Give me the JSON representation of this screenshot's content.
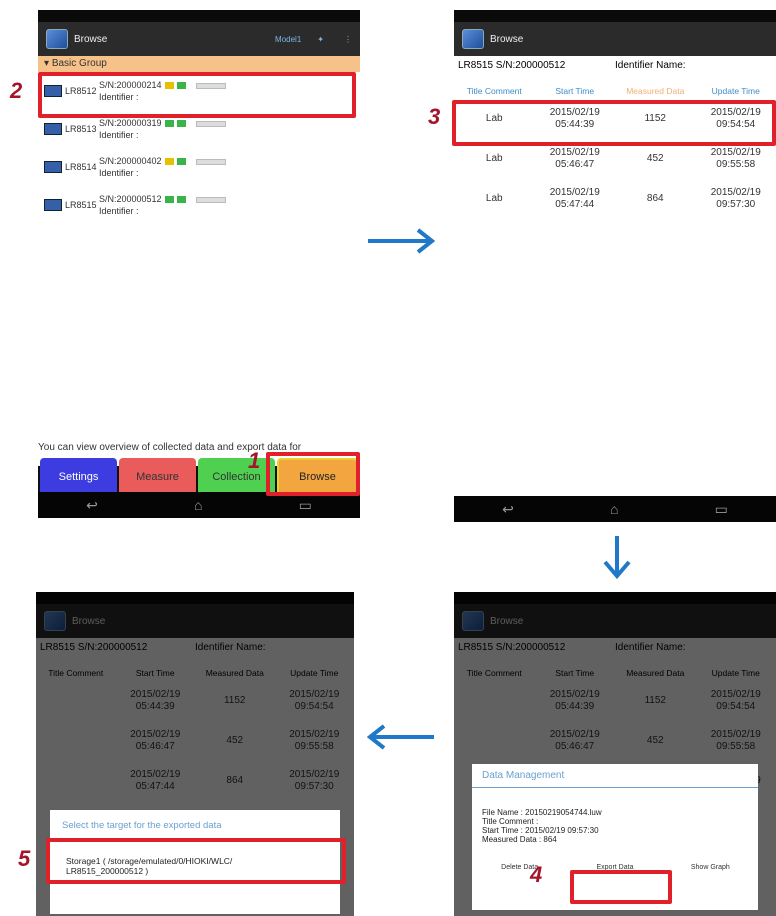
{
  "screens": {
    "s1": {
      "app_title": "Browse",
      "header_small": "Model1",
      "group": "Basic Group",
      "devices": [
        {
          "model": "LR8512",
          "serial": "S/N:200000214",
          "identifier": "Identifier :"
        },
        {
          "model": "LR8513",
          "serial": "S/N:200000319",
          "identifier": "Identifier :"
        },
        {
          "model": "LR8514",
          "serial": "S/N:200000402",
          "identifier": "Identifier :"
        },
        {
          "model": "LR8515",
          "serial": "S/N:200000512",
          "identifier": "Identifier :"
        }
      ],
      "hint": "You can view overview of collected data and export data for",
      "tabs": {
        "settings": "Settings",
        "measure": "Measure",
        "collection": "Collection",
        "browse": "Browse"
      }
    },
    "s2": {
      "app_title": "Browse",
      "device_line": "LR8515 S/N:200000512",
      "identifier_label": "Identifier Name:",
      "columns": [
        "Title Comment",
        "Start Time",
        "Measured Data",
        "Update Time"
      ],
      "rows": [
        {
          "title": "Lab",
          "start_date": "2015/02/19",
          "start_time": "05:44:39",
          "measured": "1152",
          "update_date": "2015/02/19",
          "update_time": "09:54:54"
        },
        {
          "title": "Lab",
          "start_date": "2015/02/19",
          "start_time": "05:46:47",
          "measured": "452",
          "update_date": "2015/02/19",
          "update_time": "09:55:58"
        },
        {
          "title": "Lab",
          "start_date": "2015/02/19",
          "start_time": "05:47:44",
          "measured": "864",
          "update_date": "2015/02/19",
          "update_time": "09:57:30"
        }
      ]
    },
    "s3": {
      "dialog_title": "Data Management",
      "file_name": "File Name : 20150219054744.luw",
      "title_comment": "Title Comment :",
      "start_time": "Start Time : 2015/02/19   09:57:30",
      "measured": "Measured Data : 864",
      "buttons": {
        "delete": "Delete Data",
        "export": "Export Data",
        "graph": "Show Graph"
      }
    },
    "s4": {
      "dialog_title": "Select the target for the exported data",
      "storage_line1": "Storage1 ( /storage/emulated/0/HIOKI/WLC/",
      "storage_line2": "LR8515_200000512 )"
    }
  },
  "steps": [
    "1",
    "2",
    "3",
    "4",
    "5"
  ],
  "colors": {
    "annotation": "#e0202a",
    "arrow": "#1f78c8",
    "step_number": "#a4142a"
  }
}
